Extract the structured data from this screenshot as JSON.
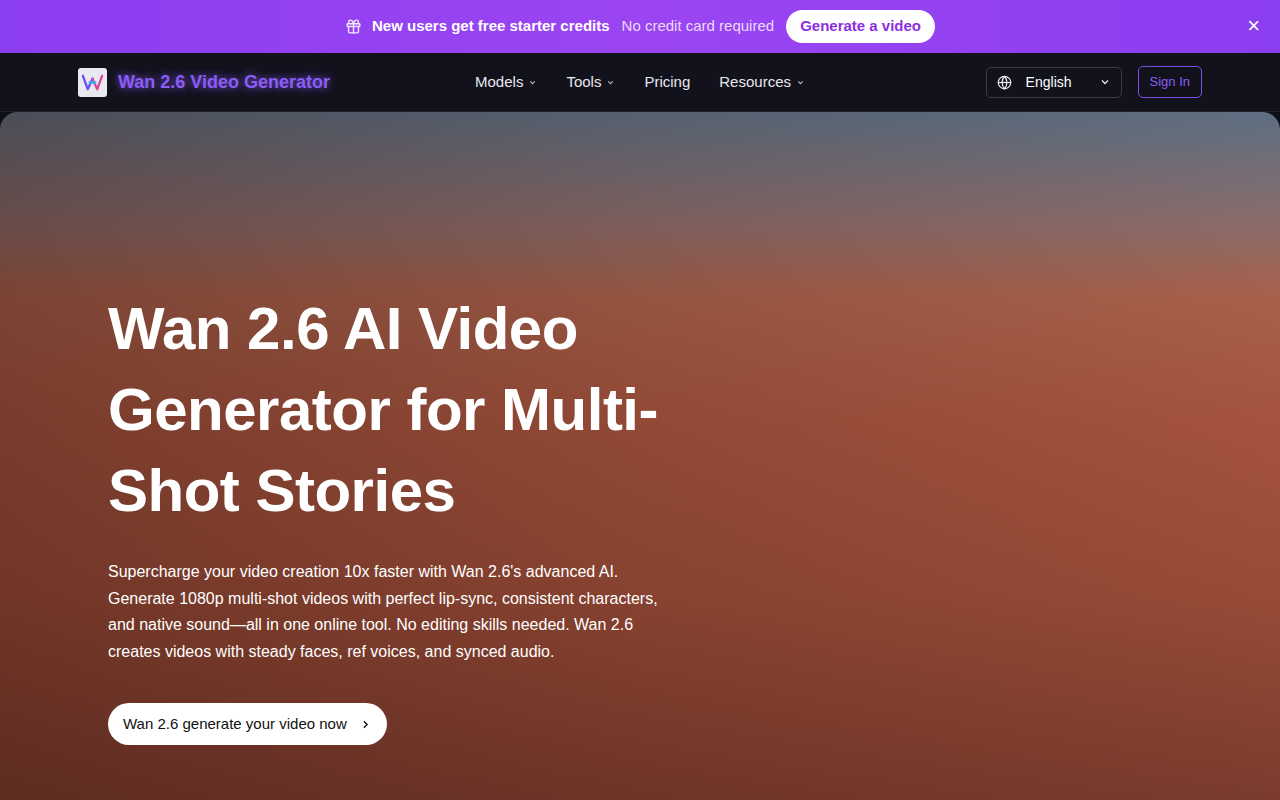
{
  "banner": {
    "title": "New users get free starter credits",
    "subtitle": "No credit card required",
    "cta": "Generate a video",
    "close": "×"
  },
  "nav": {
    "logo_text": "Wan 2.6 Video Generator",
    "items": [
      {
        "label": "Models",
        "dropdown": true
      },
      {
        "label": "Tools",
        "dropdown": true
      },
      {
        "label": "Pricing",
        "dropdown": false
      },
      {
        "label": "Resources",
        "dropdown": true
      }
    ],
    "language": "English",
    "sign_in": "Sign In"
  },
  "hero": {
    "heading": "Wan 2.6 AI Video Generator for Multi-Shot Stories",
    "description": "Supercharge your video creation 10x faster with Wan 2.6's advanced AI. Generate 1080p multi-shot videos with perfect lip-sync, consistent characters, and native sound—all in one online tool. No editing skills needed. Wan 2.6 creates videos with steady faces, ref voices, and synced audio.",
    "cta": "Wan 2.6 generate your video now"
  }
}
